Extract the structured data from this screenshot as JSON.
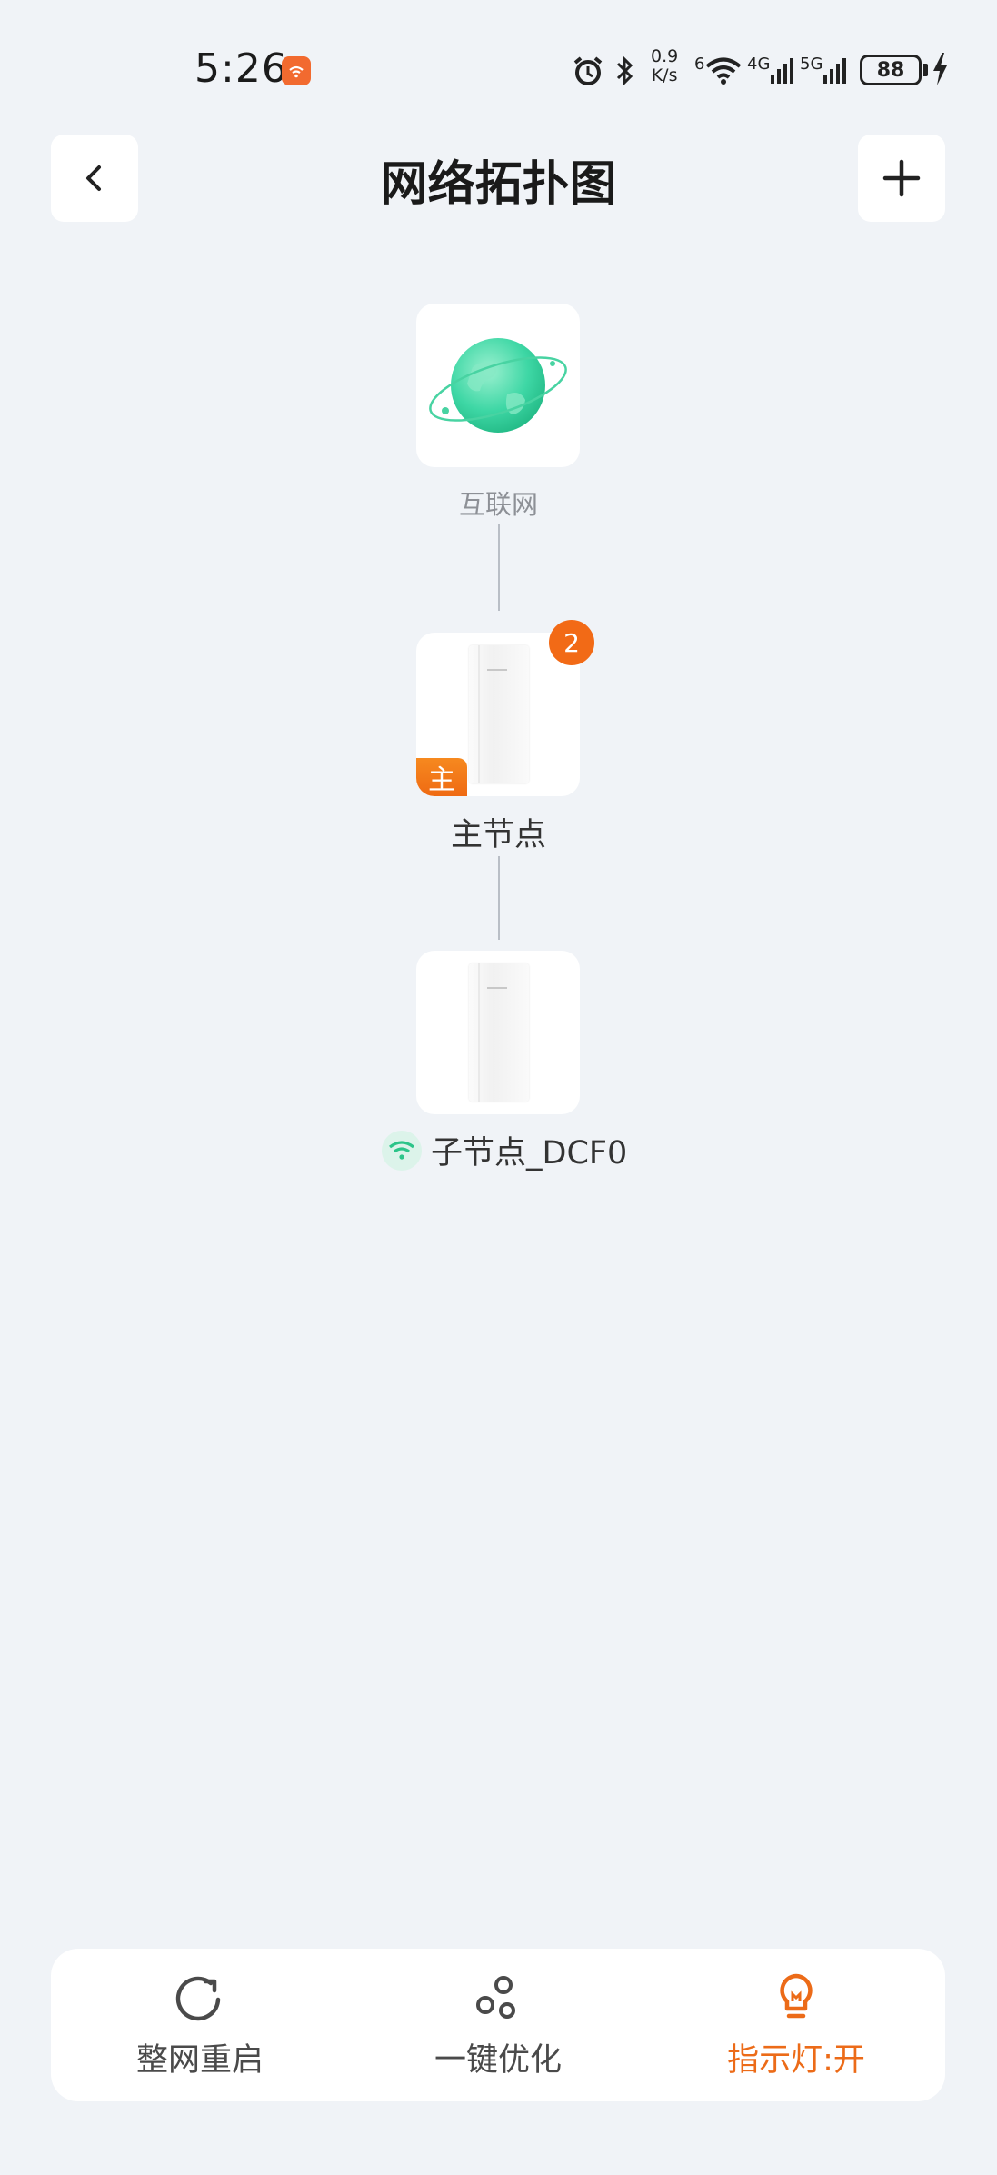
{
  "status_bar": {
    "time": "5:26",
    "net_speed_value": "0.9",
    "net_speed_unit": "K/s",
    "wifi_level": "6",
    "sim1_type": "4G",
    "sim2_type": "5G",
    "battery": "88"
  },
  "header": {
    "title": "网络拓扑图"
  },
  "topology": {
    "internet_label": "互联网",
    "main_node": {
      "label": "主节点",
      "badge_role": "主",
      "badge_count": "2"
    },
    "sub_node": {
      "label": "子节点_DCF0",
      "connection": "wifi-icon"
    }
  },
  "bottom_bar": {
    "restart_label": "整网重启",
    "optimize_label": "一键优化",
    "indicator_label": "指示灯:开"
  },
  "colors": {
    "accent": "#ec6b18",
    "badge": "#f26a16",
    "wifi_green": "#2cc489",
    "background": "#f0f3f7"
  }
}
